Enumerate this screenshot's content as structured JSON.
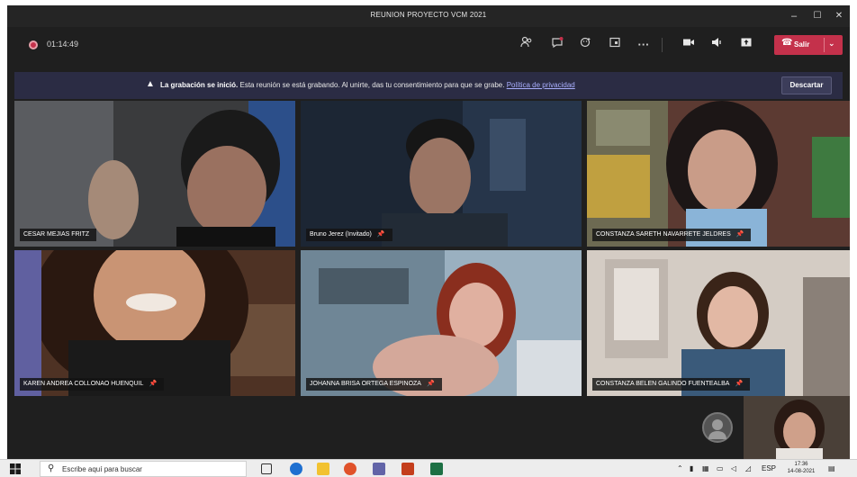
{
  "window": {
    "title": "REUNION PROYECTO VCM 2021",
    "controls": {
      "minimize": "–",
      "maximize": "☐",
      "close": "✕"
    }
  },
  "toolbar": {
    "timer": "01:14:49",
    "buttons": [
      {
        "icon": "participants-icon",
        "glyph": "⚇"
      },
      {
        "icon": "chat-icon",
        "glyph": "☁"
      },
      {
        "icon": "reactions-icon",
        "glyph": "☺"
      },
      {
        "icon": "rooms-icon",
        "glyph": "▣"
      },
      {
        "icon": "more-icon",
        "glyph": "···"
      },
      {
        "icon": "camera-icon",
        "glyph": "■"
      },
      {
        "icon": "speaker-icon",
        "glyph": "◀"
      },
      {
        "icon": "share-icon",
        "glyph": "⬆"
      }
    ],
    "leave_label": "Salir"
  },
  "banner": {
    "bold": "La grabación se inició.",
    "text": "Esta reunión se está grabando. Al unirte, das tu consentimiento para que se grabe.",
    "link": "Política de privacidad",
    "dismiss": "Descartar"
  },
  "participants": [
    {
      "name": "CESAR MEJIAS FRITZ",
      "pinned": false
    },
    {
      "name": "Bruno Jerez (Invitado)",
      "pinned": true
    },
    {
      "name": "CONSTANZA SARETH NAVARRETE JELDRES",
      "pinned": true
    },
    {
      "name": "KAREN ANDREA COLLONAO HUENQUIL",
      "pinned": true
    },
    {
      "name": "JOHANNA BRISA ORTEGA ESPINOZA",
      "pinned": true
    },
    {
      "name": "CONSTANZA BELEN GALINDO FUENTEALBA",
      "pinned": true
    }
  ],
  "taskbar": {
    "search_placeholder": "Escribe aquí para buscar",
    "lang": "ESP",
    "time": "17:36",
    "date": "14-08-2021"
  },
  "colors": {
    "leave": "#c4314b",
    "banner": "#2b2c44",
    "window": "#1f1f1f"
  }
}
